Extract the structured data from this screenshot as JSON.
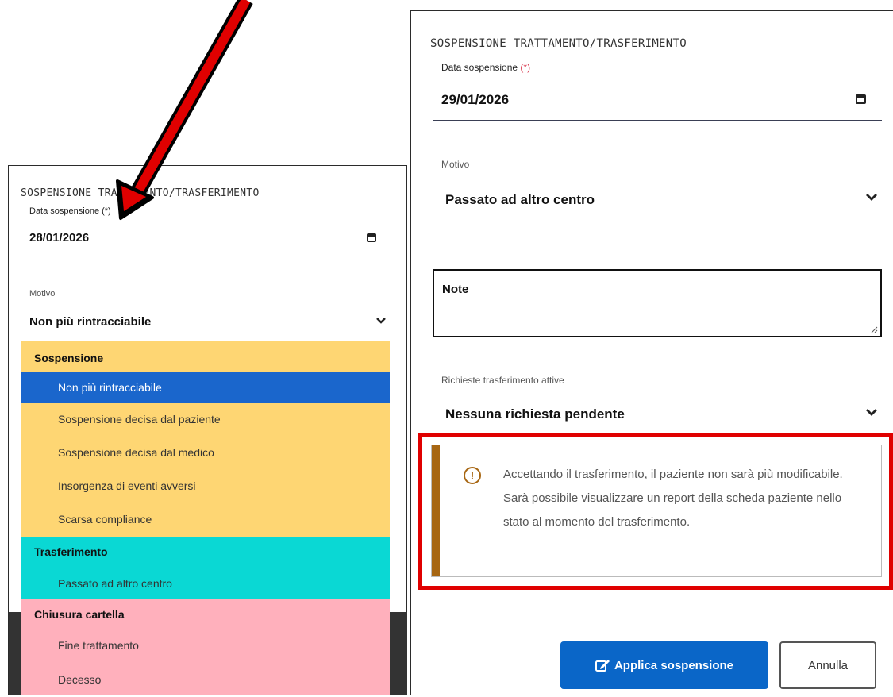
{
  "left_form": {
    "section_title": "SOSPENSIONE TRATTAMENTO/TRASFERIMENTO",
    "date_label": "Data sospensione (*)",
    "date_value": "28/01/2026",
    "reason_label": "Motivo",
    "reason_value": "Non più rintracciabile",
    "dropdown": {
      "groups": [
        {
          "label": "Sospensione",
          "color": "#fed673",
          "options": [
            "Non più rintracciabile",
            "Sospensione decisa dal paziente",
            "Sospensione decisa dal medico",
            "Insorgenza di eventi avversi",
            "Scarsa compliance"
          ]
        },
        {
          "label": "Trasferimento",
          "color": "#0ad8d4",
          "options": [
            "Passato ad altro centro"
          ]
        },
        {
          "label": "Chiusura cartella",
          "color": "#ffb0bc",
          "options": [
            "Fine trattamento",
            "Decesso"
          ]
        }
      ],
      "selected": "Non più rintracciabile",
      "selected_color": "#1a66cc"
    }
  },
  "right_form": {
    "section_title": "SOSPENSIONE TRATTAMENTO/TRASFERIMENTO",
    "date_label": "Data sospensione ",
    "date_required_mark": "(*)",
    "date_value": "29/01/2026",
    "reason_label": "Motivo",
    "reason_value": "Passato ad altro centro",
    "notes_label": "Note",
    "transfer_label": "Richieste trasferimento attive",
    "transfer_value": "Nessuna richiesta pendente",
    "warning_icon": "!",
    "warning_text": "Accettando il trasferimento, il paziente non sarà più modificabile. Sarà possibile visualizzare un report della scheda paziente nello stato al momento del trasferimento.",
    "apply_button": "Applica sospensione",
    "cancel_button": "Annulla"
  },
  "annotations": {
    "arrow_color": "#e00000",
    "highlight_color": "#e00000"
  }
}
